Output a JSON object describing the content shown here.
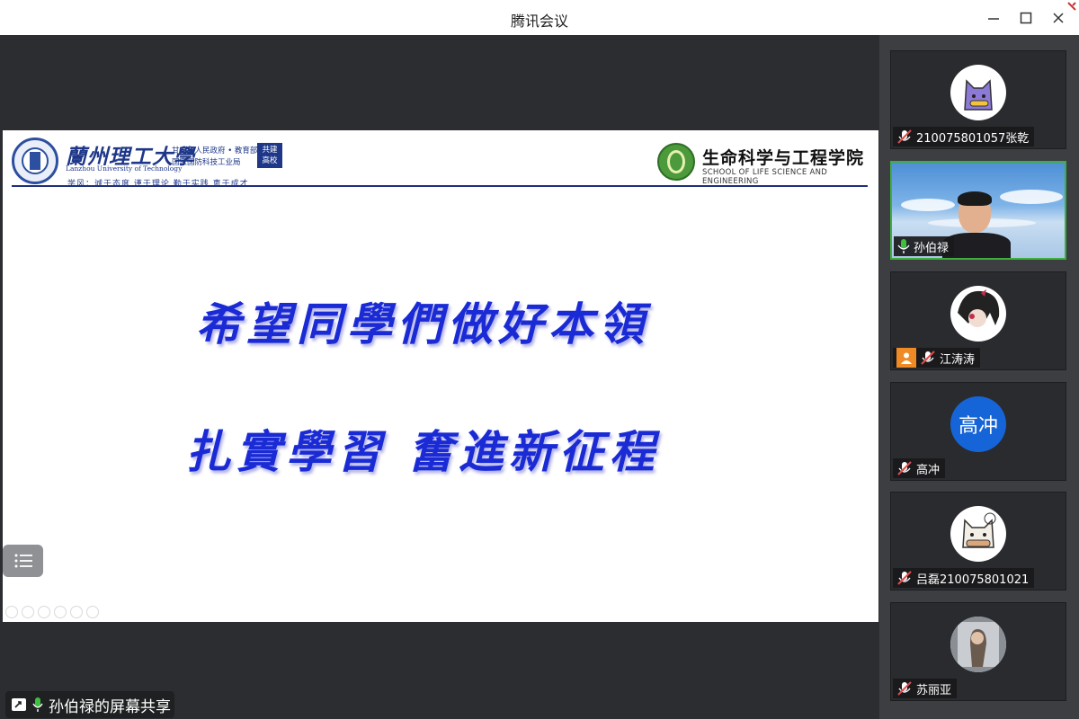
{
  "window": {
    "title": "腾讯会议"
  },
  "slide": {
    "university_cn": "蘭州理工大學",
    "university_en": "Lanzhou University of Technology",
    "sponsor_line1": "甘肃省人民政府 • 教育部",
    "sponsor_line2": "国家国防科技工业局",
    "badge_line1": "共建",
    "badge_line2": "高校",
    "motto": "学风：诚于态度 谨于理论 勤于实践 恵于成才",
    "school_cn": "生命科学与工程学院",
    "school_en": "SCHOOL OF LIFE SCIENCE AND ENGINEERING",
    "line1": "希望同學們做好本領",
    "line2": "扎實學習 奮進新征程"
  },
  "share_label": "孙伯禄的屏幕共享",
  "participants": [
    {
      "name": "210075801057张乾",
      "mic": "muted",
      "avatar": "cat-avatar"
    },
    {
      "name": "孙伯禄",
      "mic": "active",
      "avatar": "camera-video"
    },
    {
      "name": "江涛涛",
      "mic": "muted",
      "avatar": "anime-avatar"
    },
    {
      "name": "高冲",
      "mic": "muted",
      "avatar": "text-avatar",
      "initials": "高冲"
    },
    {
      "name": "吕磊210075801021",
      "mic": "muted",
      "avatar": "cat-avatar-2"
    },
    {
      "name": "苏丽亚",
      "mic": "muted",
      "avatar": "photo-avatar"
    }
  ],
  "colors": {
    "accent_green": "#3fae3f",
    "muted_red": "#e24a4a",
    "avatar_blue": "#1565d8",
    "calligraphy_blue": "#1a2bd6"
  }
}
